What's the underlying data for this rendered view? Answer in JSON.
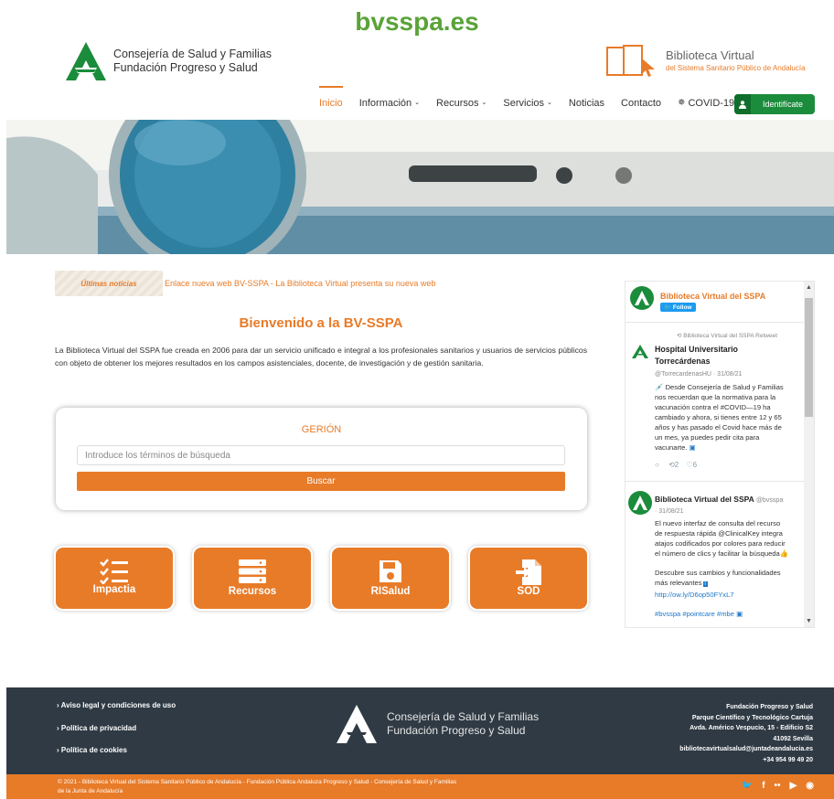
{
  "site_title": "bvsspa.es",
  "header": {
    "org_line1": "Consejería de Salud y Familias",
    "org_line2": "Fundación Progreso y Salud",
    "library_title": "Biblioteca Virtual",
    "library_subtitle": "del Sistema Sanitario Público de Andalucía"
  },
  "nav": {
    "items": [
      {
        "label": "Inicio",
        "active": true
      },
      {
        "label": "Información",
        "dropdown": true
      },
      {
        "label": "Recursos",
        "dropdown": true
      },
      {
        "label": "Servicios",
        "dropdown": true
      },
      {
        "label": "Noticias"
      },
      {
        "label": "Contacto"
      },
      {
        "label": "COVID-19",
        "dropdown": true
      }
    ],
    "login_label": "Identifícate"
  },
  "ticker": {
    "badge": "Últimas noticias",
    "items": "Enlace nueva web BV-SSPA   -   La Biblioteca Virtual presenta su nueva web"
  },
  "welcome": {
    "title": "Bienvenido a la BV-SSPA",
    "text": "La Biblioteca Virtual del SSPA fue creada en 2006 para dar un servicio unificado e integral a los profesionales sanitarios y usuarios de servicios públicos con objeto de obtener los mejores resultados en los campos asistenciales, docente, de investigación y de gestión sanitaria."
  },
  "search": {
    "title": "GERIÓN",
    "placeholder": "Introduce los términos de búsqueda",
    "button": "Buscar"
  },
  "tiles": [
    {
      "label": "Impactia",
      "icon": "checklist-icon"
    },
    {
      "label": "Recursos",
      "icon": "server-icon"
    },
    {
      "label": "RISalud",
      "icon": "floppy-disk-icon"
    },
    {
      "label": "SOD",
      "icon": "document-import-icon"
    }
  ],
  "twitter": {
    "account": "Biblioteca Virtual del SSPA",
    "follow": "Follow",
    "retweet_note": "Biblioteca Virtual del SSPA Retweet",
    "tweet1": {
      "name_line1": "Hospital Universitario",
      "name_line2": "Torrecárdenas",
      "handle_date": "@TorrecardenasHU · 31/08/21",
      "text": [
        "💉 Desde Consejería de Salud y Familias",
        "nos recuerdan que la normativa para la",
        "vacunación contra el #COVID—19 ha",
        "cambiado y ahora, si tienes entre 12 y 65",
        "años y has pasado el Covid hace más de",
        "un mes, ya puedes pedir cita para",
        "vacunarte."
      ],
      "retweets": "2",
      "likes": "6"
    },
    "tweet2": {
      "name": "Biblioteca Virtual del SSPA",
      "handle": "@bvsspa",
      "date": "· 31/08/21",
      "text": [
        "El nuevo interfaz de consulta del recurso",
        "de respuesta rápida @ClinicalKey integra",
        "atajos codificados por colores para reducir",
        "el número de clics y facilitar la búsqueda👍"
      ],
      "text2": [
        "Descubre sus cambios y funcionalidades",
        "más relevantes"
      ],
      "link": "http://ow.ly/D6op50FYxL7",
      "tags": "#bvsspa #pointcare #mbe"
    }
  },
  "footer": {
    "links": [
      "Aviso legal y condiciones de uso",
      "Política de privacidad",
      "Política de cookies"
    ],
    "org_line1": "Consejería de Salud y Familias",
    "org_line2": "Fundación Progreso y Salud",
    "address": [
      "Fundación Progreso y Salud",
      "Parque Científico y Tecnológico Cartuja",
      "Avda. Américo Vespucio, 15 - Edificio S2",
      "41092 Sevilla",
      "bibliotecavirtualsalud@juntadeandalucia.es",
      "+34 954 99 49 20"
    ],
    "copyright_line1": "© 2021 - Biblioteca Virtual del Sistema Sanitario Público de Andalucía - Fundación Pública Andaluza Progreso y Salud - Consejería de Salud y Familias",
    "copyright_line2": "de la Junta de Andalucía",
    "social": [
      "twitter-icon",
      "facebook-icon",
      "flickr-icon",
      "youtube-icon",
      "rss-icon"
    ]
  },
  "colors": {
    "orange": "#e87b28",
    "green": "#1b8c3b",
    "site_title_green": "#5aa338",
    "footer_bg": "#2f3a44"
  }
}
